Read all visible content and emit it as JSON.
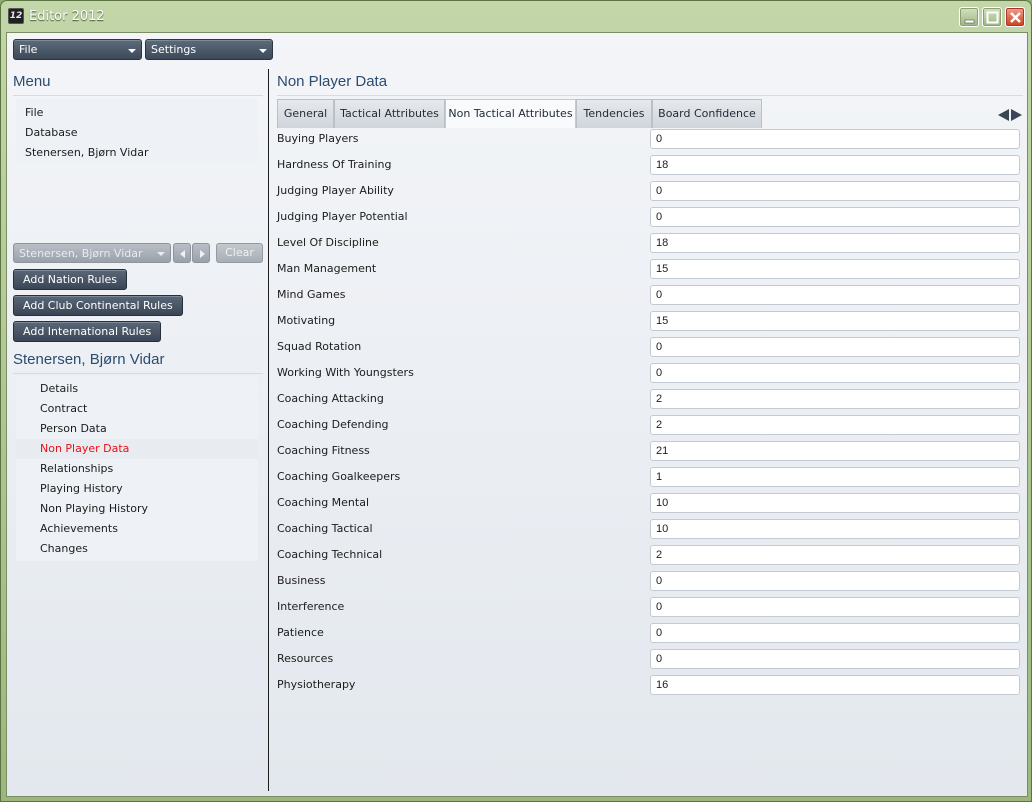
{
  "window": {
    "title": "Editor 2012",
    "icon_text": "12"
  },
  "toolbar": {
    "file_label": "File",
    "settings_label": "Settings"
  },
  "left_menu": {
    "title": "Menu",
    "items": [
      {
        "label": "File"
      },
      {
        "label": "Database"
      },
      {
        "label": "Stenersen, Bjørn Vidar"
      }
    ]
  },
  "person_picker": {
    "selected": "Stenersen, Bjørn Vidar",
    "clear_label": "Clear"
  },
  "rule_buttons": [
    {
      "label": "Add Nation Rules"
    },
    {
      "label": "Add Club Continental Rules"
    },
    {
      "label": "Add International Rules"
    }
  ],
  "person_panel": {
    "title": "Stenersen, Bjørn Vidar",
    "items": [
      {
        "label": "Details",
        "active": false
      },
      {
        "label": "Contract",
        "active": false
      },
      {
        "label": "Person Data",
        "active": false
      },
      {
        "label": "Non Player Data",
        "active": true
      },
      {
        "label": "Relationships",
        "active": false
      },
      {
        "label": "Playing History",
        "active": false
      },
      {
        "label": "Non Playing History",
        "active": false
      },
      {
        "label": "Achievements",
        "active": false
      },
      {
        "label": "Changes",
        "active": false
      }
    ]
  },
  "main": {
    "title": "Non Player Data",
    "tabs": [
      {
        "label": "General",
        "active": false
      },
      {
        "label": "Tactical Attributes",
        "active": false
      },
      {
        "label": "Non Tactical Attributes",
        "active": true
      },
      {
        "label": "Tendencies",
        "active": false
      },
      {
        "label": "Board Confidence",
        "active": false
      }
    ],
    "fields": [
      {
        "label": "Buying Players",
        "value": "0"
      },
      {
        "label": "Hardness Of Training",
        "value": "18"
      },
      {
        "label": "Judging Player Ability",
        "value": "0"
      },
      {
        "label": "Judging Player Potential",
        "value": "0"
      },
      {
        "label": "Level Of Discipline",
        "value": "18"
      },
      {
        "label": "Man Management",
        "value": "15"
      },
      {
        "label": "Mind Games",
        "value": "0"
      },
      {
        "label": "Motivating",
        "value": "15"
      },
      {
        "label": "Squad Rotation",
        "value": "0"
      },
      {
        "label": "Working With Youngsters",
        "value": "0"
      },
      {
        "label": "Coaching Attacking",
        "value": "2"
      },
      {
        "label": "Coaching Defending",
        "value": "2"
      },
      {
        "label": "Coaching Fitness",
        "value": "21"
      },
      {
        "label": "Coaching Goalkeepers",
        "value": "1"
      },
      {
        "label": "Coaching Mental",
        "value": "10"
      },
      {
        "label": "Coaching Tactical",
        "value": "10"
      },
      {
        "label": "Coaching Technical",
        "value": "2"
      },
      {
        "label": "Business",
        "value": "0"
      },
      {
        "label": "Interference",
        "value": "0"
      },
      {
        "label": "Patience",
        "value": "0"
      },
      {
        "label": "Resources",
        "value": "0"
      },
      {
        "label": "Physiotherapy",
        "value": "16"
      }
    ]
  },
  "colors": {
    "accent_title": "#2b4c6f",
    "active_item": "#e8101a",
    "button_dark": "#3c4958",
    "frame_green": "#9cb77c"
  },
  "icons": {
    "minimize": "minimize-icon",
    "maximize": "maximize-icon",
    "close": "close-icon",
    "tab_prev": "arrow-left-icon",
    "tab_next": "arrow-right-icon"
  }
}
